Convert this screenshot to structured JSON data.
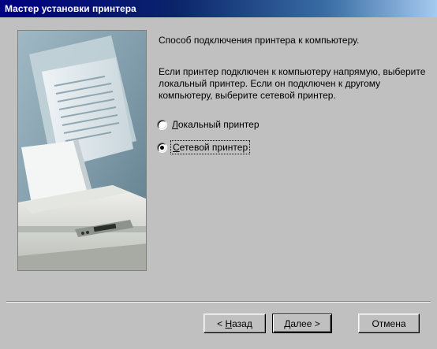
{
  "window": {
    "title": "Мастер установки принтера"
  },
  "content": {
    "heading": "Способ подключения принтера к компьютеру.",
    "description": "Если принтер подключен к компьютеру напрямую, выберите локальный принтер. Если он подключен к другому компьютеру, выберите сетевой принтер."
  },
  "options": {
    "local": {
      "mnemonic": "Л",
      "rest": "окальный принтер",
      "selected": false
    },
    "network": {
      "mnemonic": "С",
      "rest": "етевой принтер",
      "selected": true
    }
  },
  "buttons": {
    "back_prefix": "< ",
    "back_mnemonic": "Н",
    "back_rest": "азад",
    "next": "Далее >",
    "cancel": "Отмена"
  },
  "icons": {
    "side_illustration": "printer-printing-document-illustration"
  }
}
